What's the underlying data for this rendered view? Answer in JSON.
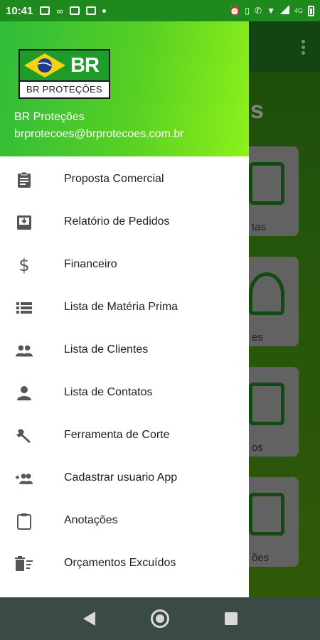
{
  "status_bar": {
    "time": "10:41",
    "network": "4G",
    "icons": [
      "message-icon",
      "voicemail-icon",
      "gmail-icon",
      "contact-card-icon",
      "dot-icon",
      "alarm-icon",
      "vibrate-icon",
      "wifi-call-icon",
      "wifi-icon",
      "signal-icon",
      "battery-icon"
    ]
  },
  "drawer": {
    "logo": {
      "badge_text": "BR",
      "caption": "BR PROTEÇÕES"
    },
    "user_name": "BR Proteções",
    "user_email": "brprotecoes@brprotecoes.com.br",
    "items": [
      {
        "label": "Proposta Comercial",
        "icon": "clipboard-icon"
      },
      {
        "label": "Relatório de Pedidos",
        "icon": "inbox-download-icon"
      },
      {
        "label": "Financeiro",
        "icon": "dollar-icon"
      },
      {
        "label": "Lista de Matéria Prima",
        "icon": "list-icon"
      },
      {
        "label": "Lista de Clientes",
        "icon": "people-icon"
      },
      {
        "label": "Lista de Contatos",
        "icon": "person-icon"
      },
      {
        "label": "Ferramenta de Corte",
        "icon": "wrench-icon"
      },
      {
        "label": "Cadastrar usuario App",
        "icon": "add-group-icon"
      },
      {
        "label": "Anotações",
        "icon": "clipboard-outline-icon"
      },
      {
        "label": "Orçamentos Excuídos",
        "icon": "delete-sweep-icon"
      }
    ]
  },
  "background_app": {
    "title_fragment": "s",
    "card_labels": [
      "tas",
      "es",
      "os",
      "ões"
    ]
  },
  "colors": {
    "status_bar": "#1e8a1e",
    "drawer_gradient_start": "#2fbc3a",
    "drawer_gradient_end": "#8ef11a",
    "icon_color": "#555555",
    "nav_bar": "#3a4a44"
  }
}
